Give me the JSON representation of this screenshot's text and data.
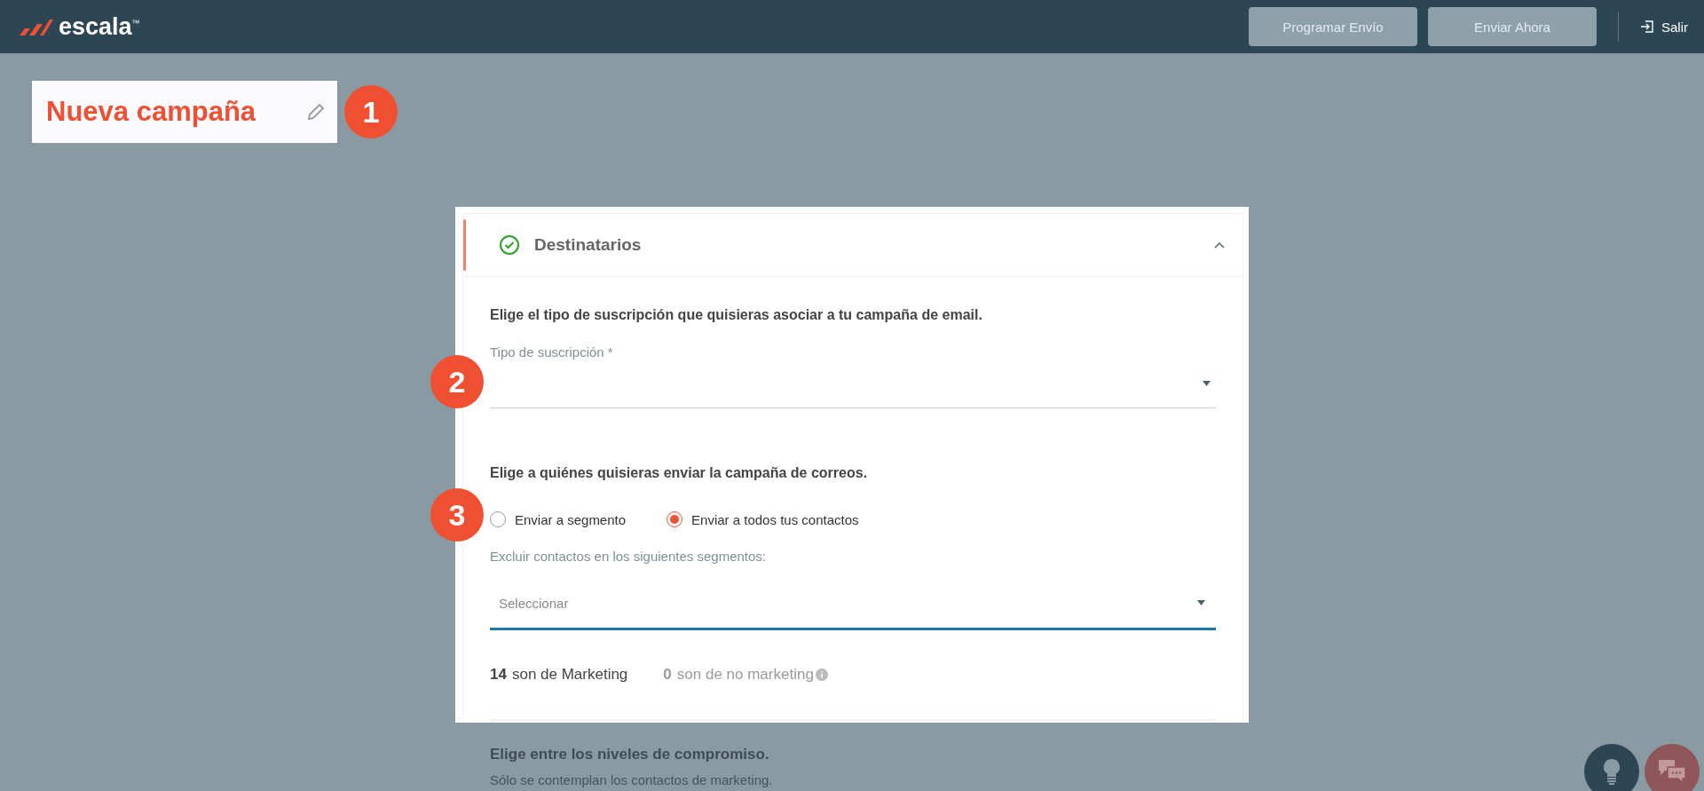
{
  "header": {
    "logo": "escala",
    "trademark": "™",
    "buttons": [
      {
        "label": "Programar Envío",
        "disabled": true
      },
      {
        "label": "Enviar Ahora",
        "disabled": true
      }
    ],
    "exit": "Salir"
  },
  "campaign": {
    "title": "Nueva campaña"
  },
  "steps": [
    "1",
    "2",
    "3"
  ],
  "section": {
    "title": "Destinatarios",
    "complete": true,
    "expanded": true
  },
  "subscription": {
    "heading": "Elige el tipo de suscripción que quisieras asociar a tu campaña de email.",
    "label": "Tipo de suscripción *"
  },
  "audience": {
    "heading": "Elige a quiénes quisieras enviar la campaña de correos.",
    "options": [
      {
        "label": "Enviar a segmento",
        "selected": false
      },
      {
        "label": "Enviar a todos tus contactos",
        "selected": true
      }
    ],
    "exclude_label": "Excluir contactos en los siguientes segmentos:",
    "exclude_placeholder": "Seleccionar",
    "marketing_count": "14",
    "marketing_text": "son de Marketing",
    "non_marketing_count": "0",
    "non_marketing_text": "son de no marketing"
  },
  "engagement": {
    "heading": "Elige entre los niveles de compromiso.",
    "note": "Sólo se contemplan los contactos de marketing."
  }
}
